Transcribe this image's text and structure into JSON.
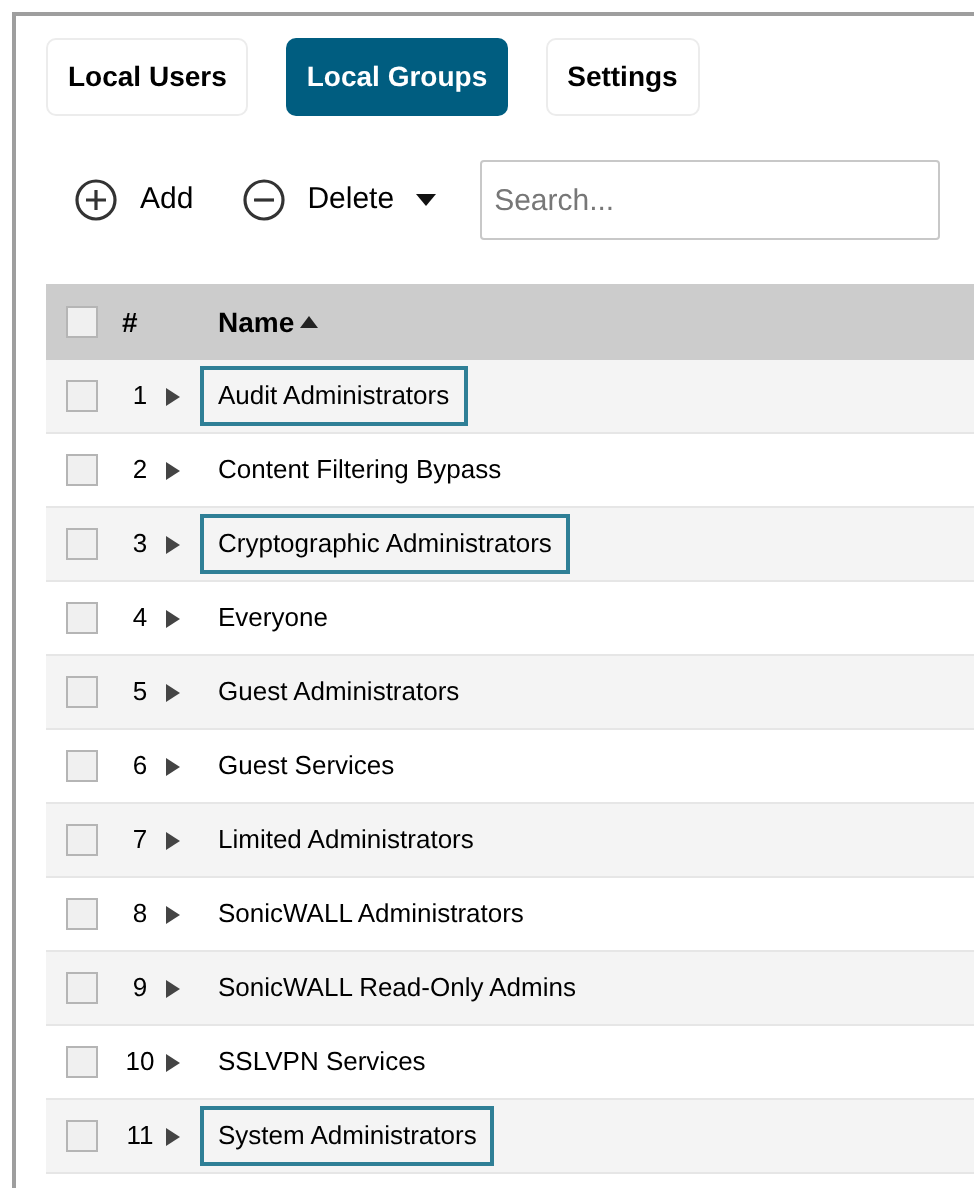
{
  "tabs": [
    {
      "label": "Local Users",
      "selected": false
    },
    {
      "label": "Local Groups",
      "selected": true
    },
    {
      "label": "Settings",
      "selected": false
    }
  ],
  "toolbar": {
    "add": "Add",
    "delete": "Delete",
    "search": {
      "placeholder": "Search..."
    }
  },
  "table": {
    "columns": [
      "#",
      "Name"
    ],
    "sort_ascending": true,
    "header_checked": false,
    "rows": [
      {
        "number": "1",
        "name": "Audit Administrators",
        "checked": false,
        "highlighted": true
      },
      {
        "number": "2",
        "name": "Content Filtering Bypass",
        "checked": false,
        "highlighted": false
      },
      {
        "number": "3",
        "name": "Cryptographic Administrators",
        "checked": false,
        "highlighted": true
      },
      {
        "number": "4",
        "name": "Everyone",
        "checked": false,
        "highlighted": false
      },
      {
        "number": "5",
        "name": "Guest Administrators",
        "checked": false,
        "highlighted": false
      },
      {
        "number": "6",
        "name": "Guest Services",
        "checked": false,
        "highlighted": false
      },
      {
        "number": "7",
        "name": "Limited Administrators",
        "checked": false,
        "highlighted": false
      },
      {
        "number": "8",
        "name": "SonicWALL Administrators",
        "checked": false,
        "highlighted": false
      },
      {
        "number": "9",
        "name": "SonicWALL Read-Only Admins",
        "checked": false,
        "highlighted": false
      },
      {
        "number": "10",
        "name": "SSLVPN Services",
        "checked": false,
        "highlighted": false
      },
      {
        "number": "11",
        "name": "System Administrators",
        "checked": false,
        "highlighted": true
      }
    ]
  }
}
